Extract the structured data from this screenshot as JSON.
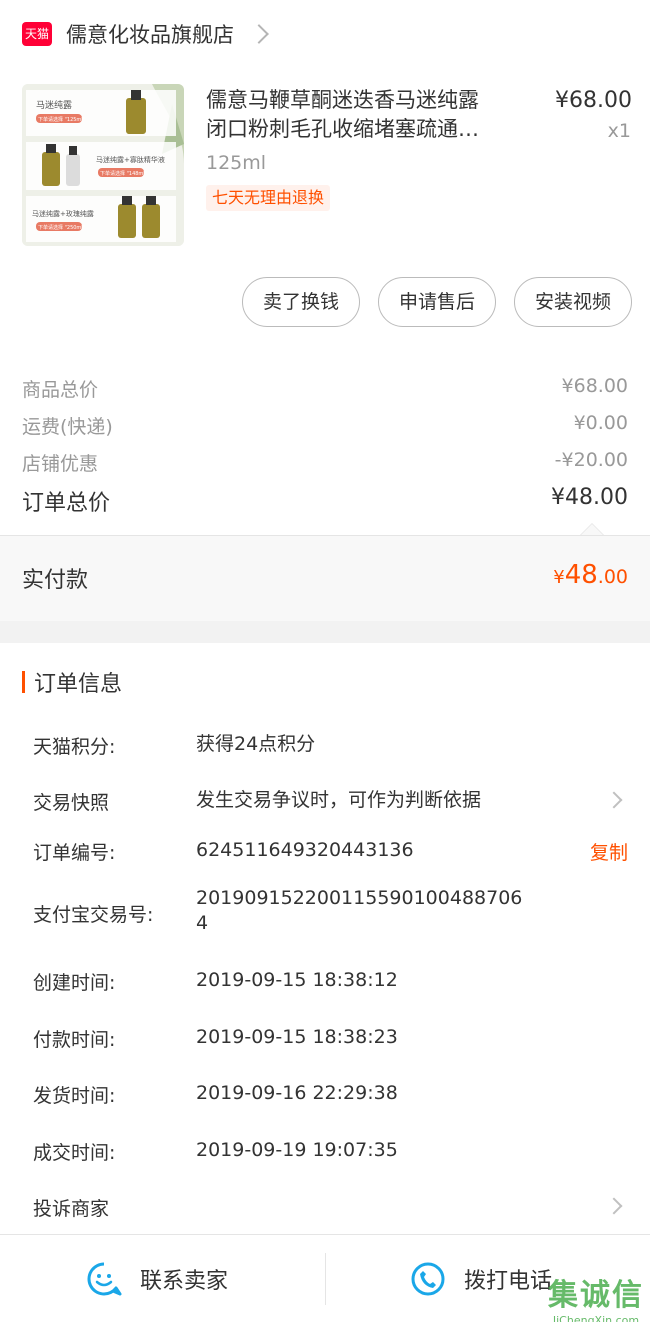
{
  "store": {
    "badge": "天猫",
    "name": "儒意化妆品旗舰店"
  },
  "product": {
    "title_line1": "儒意马鞭草酮迷迭香马迷纯露",
    "title_line2": "闭口粉刺毛孔收缩堵塞疏通…",
    "spec": "125ml",
    "tag": "七天无理由退换",
    "price": "¥68.00",
    "qty": "x1",
    "thumb_labels": [
      "马迷纯露",
      "马迷纯露+寡肽精华液",
      "马迷纯露+玫瑰纯露"
    ],
    "thumb_pills": [
      "下单请选择 \"125ml\"",
      "下单请选择 \"148ml\"",
      "下单请选择 \"250ml\""
    ]
  },
  "actions": [
    "卖了换钱",
    "申请售后",
    "安装视频"
  ],
  "summary": {
    "rows": [
      {
        "label": "商品总价",
        "value": "¥68.00"
      },
      {
        "label": "运费(快递)",
        "value": "¥0.00"
      },
      {
        "label": "店铺优惠",
        "value": "-¥20.00"
      }
    ],
    "total_label": "订单总价",
    "total_value": "¥48.00"
  },
  "payment": {
    "label": "实付款",
    "currency": "¥",
    "integer": "48",
    "decimal": ".00"
  },
  "order_info": {
    "title": "订单信息",
    "rows": [
      {
        "label": "天猫积分:",
        "value": "获得24点积分"
      },
      {
        "label": "交易快照",
        "value": "发生交易争议时，可作为判断依据"
      },
      {
        "label": "订单编号:",
        "value": "624511649320443136",
        "action": "复制"
      },
      {
        "label": "支付宝交易号:",
        "value_line1": "201909152200115590100488706",
        "value_line2": "4"
      },
      {
        "label": "创建时间:",
        "value": "2019-09-15 18:38:12"
      },
      {
        "label": "付款时间:",
        "value": "2019-09-15 18:38:23"
      },
      {
        "label": "发货时间:",
        "value": "2019-09-16 22:29:38"
      },
      {
        "label": "成交时间:",
        "value": "2019-09-19 19:07:35"
      },
      {
        "label": "投诉商家"
      }
    ]
  },
  "bottom": {
    "contact": "联系卖家",
    "call": "拨打电话"
  },
  "watermark": {
    "text": "集诚信",
    "url": "JiChengXin.com"
  },
  "colors": {
    "accent": "#ff5000",
    "tmall": "#ff0036",
    "icon_blue": "#1aa7e8"
  }
}
